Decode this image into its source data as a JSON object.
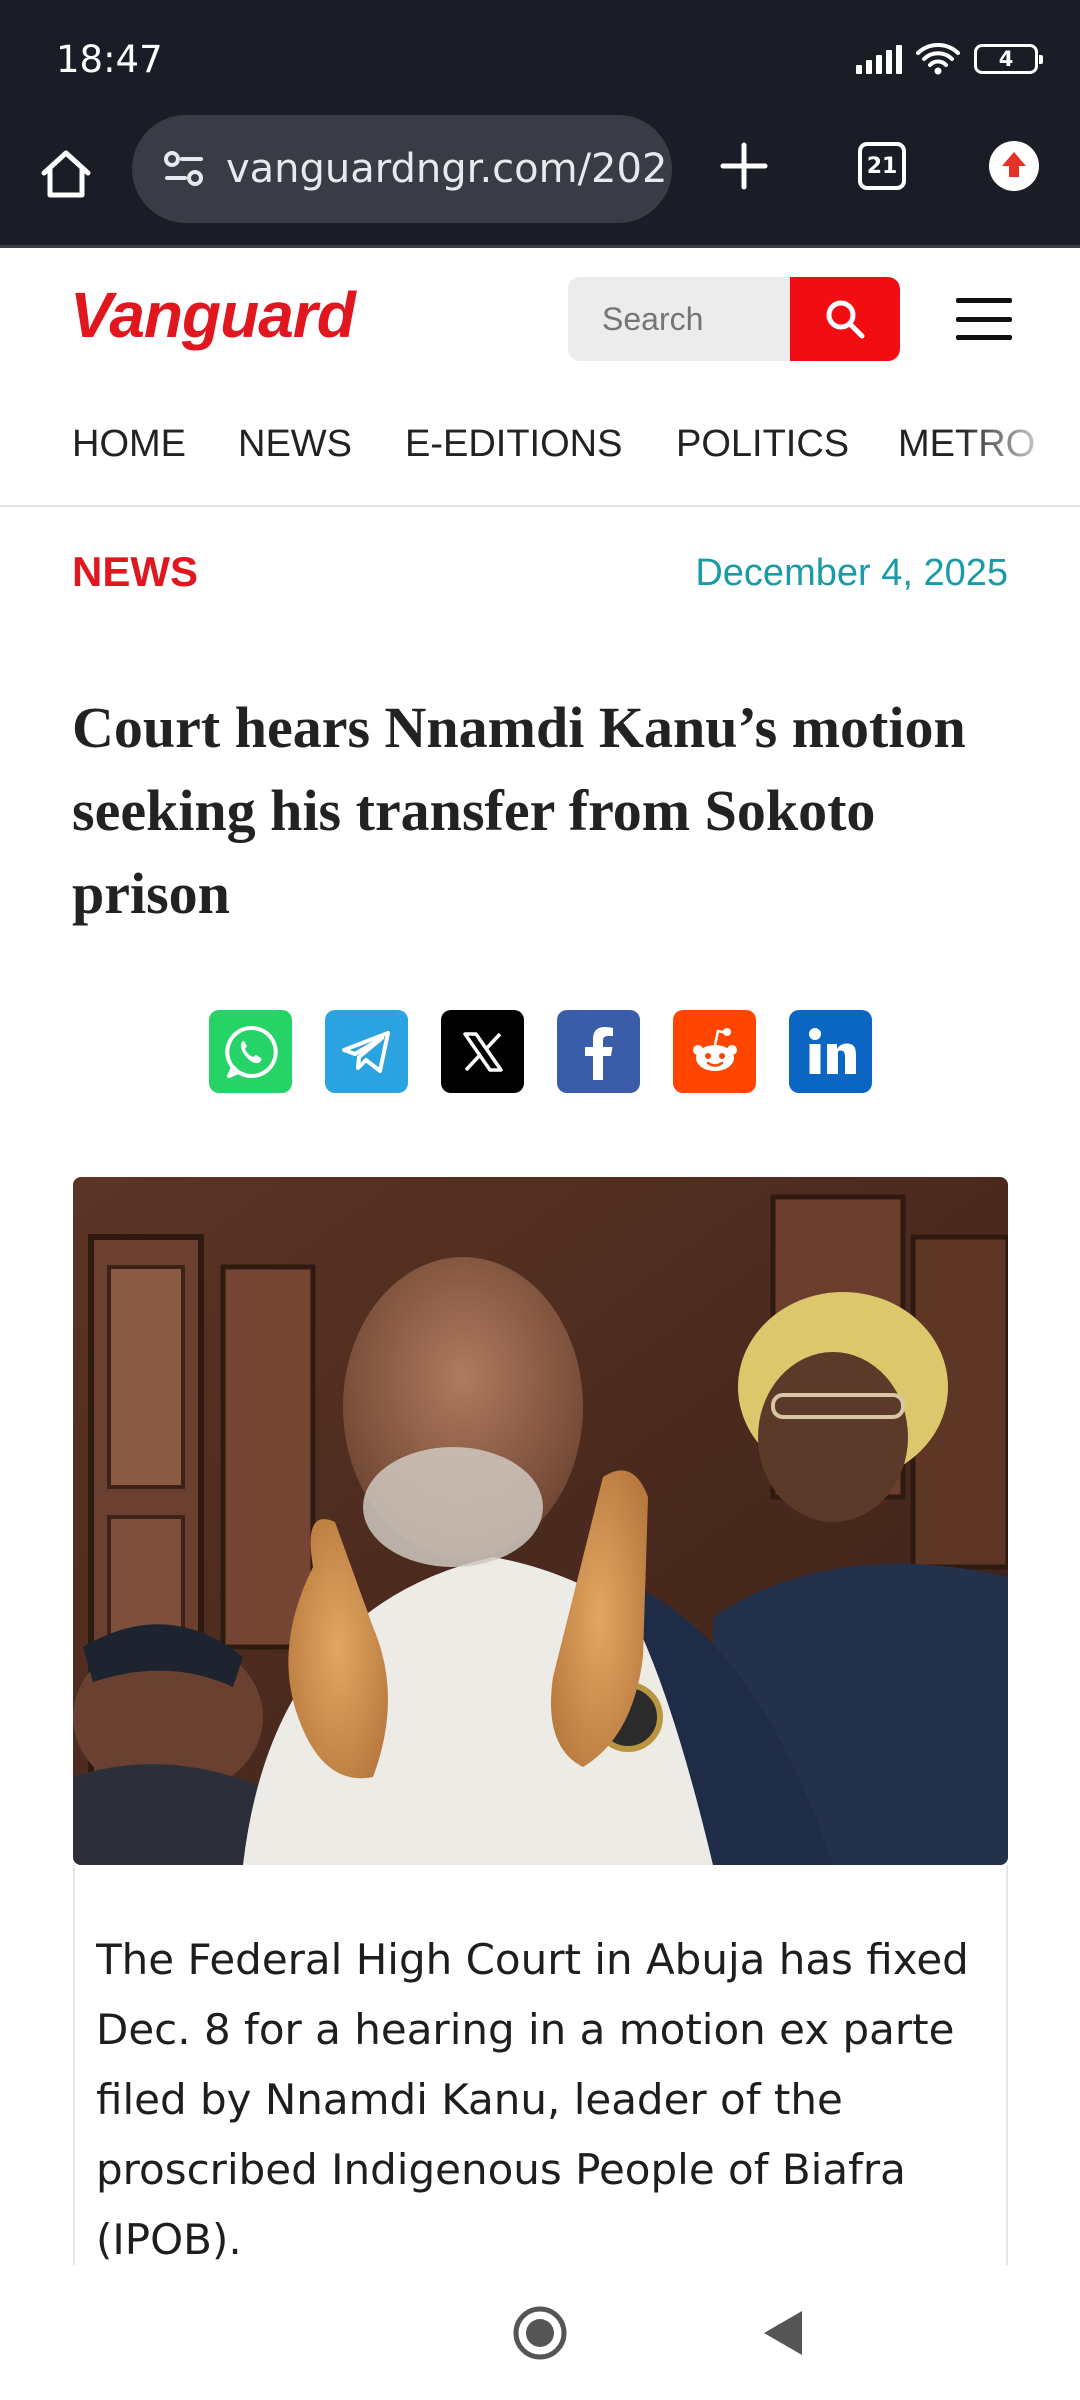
{
  "status_bar": {
    "time": "18:47",
    "battery_level": "4"
  },
  "browser": {
    "url": "vanguardngr.com/202",
    "tab_count": "21",
    "icons": [
      "home-icon",
      "site-settings-icon",
      "new-tab-icon",
      "tabs-icon",
      "update-icon"
    ]
  },
  "site": {
    "logo": "Vanguard",
    "search_placeholder": "Search",
    "brand_color": "#e1171f"
  },
  "nav": {
    "items": [
      "HOME",
      "NEWS",
      "E-EDITIONS",
      "POLITICS",
      "METRO"
    ]
  },
  "article": {
    "category": "NEWS",
    "date": "December 4, 2025",
    "headline": "Court hears Nnamdi Kanu’s motion seeking his transfer from Sokoto prison",
    "body": "The Federal High Court in Abuja has fixed Dec. 8 for a hearing in a motion ex parte filed by Nnamdi Kanu, leader of the proscribed Indigenous People of Biafra (IPOB)."
  },
  "share": {
    "buttons": [
      {
        "name": "whatsapp",
        "color": "#25d366"
      },
      {
        "name": "telegram",
        "color": "#2aa3e0"
      },
      {
        "name": "x",
        "color": "#000000"
      },
      {
        "name": "facebook",
        "color": "#3b5ca8"
      },
      {
        "name": "reddit",
        "color": "#ff4500"
      },
      {
        "name": "linkedin",
        "color": "#0a66c2"
      }
    ]
  }
}
